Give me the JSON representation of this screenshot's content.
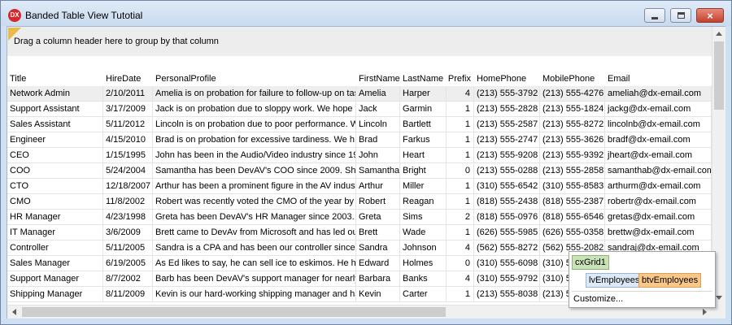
{
  "window": {
    "title": "Banded Table View Tutotial",
    "app_icon": "DX",
    "controls": {
      "minimize": "minimize-icon",
      "maximize": "maximize-icon",
      "close": "×"
    }
  },
  "group_panel": {
    "text": "Drag a column header here to group by that column"
  },
  "columns": [
    "Title",
    "HireDate",
    "PersonalProfile",
    "FirstName",
    "LastName",
    "Prefix",
    "HomePhone",
    "MobilePhone",
    "Email"
  ],
  "rows": [
    [
      "Network Admin",
      "2/10/2011",
      "Amelia is on probation for failure to follow-up on tas",
      "Amelia",
      "Harper",
      "4",
      "(213) 555-3792",
      "(213) 555-4276",
      "ameliah@dx-email.com"
    ],
    [
      "Support Assistant",
      "3/17/2009",
      "Jack is on probation due to sloppy work. We hope t",
      "Jack",
      "Garmin",
      "1",
      "(213) 555-2828",
      "(213) 555-1824",
      "jackg@dx-email.com"
    ],
    [
      "Sales Assistant",
      "5/11/2012",
      "Lincoln is on probation due to poor performance. W",
      "Lincoln",
      "Bartlett",
      "1",
      "(213) 555-2587",
      "(213) 555-8272",
      "lincolnb@dx-email.com"
    ],
    [
      "Engineer",
      "4/15/2010",
      "Brad is on probation for excessive tardiness.  We h",
      "Brad",
      "Farkus",
      "1",
      "(213) 555-2747",
      "(213) 555-3626",
      "bradf@dx-email.com"
    ],
    [
      "CEO",
      "1/15/1995",
      "John has been in the Audio/Video industry since 19",
      "John",
      "Heart",
      "1",
      "(213) 555-9208",
      "(213) 555-9392",
      "jheart@dx-email.com"
    ],
    [
      "COO",
      "5/24/2004",
      "Samantha has been DevAV's COO since 2009. She",
      "Samantha",
      "Bright",
      "0",
      "(213) 555-0288",
      "(213) 555-2858",
      "samanthab@dx-email.com"
    ],
    [
      "CTO",
      "12/18/2007",
      "Arthur has been a prominent figure in the AV indust",
      "Arthur",
      "Miller",
      "1",
      "(310) 555-6542",
      "(310) 555-8583",
      "arthurm@dx-email.com"
    ],
    [
      "CMO",
      "11/8/2002",
      "Robert was recently voted the CMO of the year by",
      "Robert",
      "Reagan",
      "1",
      "(818) 555-2438",
      "(818) 555-2387",
      "robertr@dx-email.com"
    ],
    [
      "HR Manager",
      "4/23/1998",
      "Greta has been DevAV's HR Manager since 2003. S",
      "Greta",
      "Sims",
      "2",
      "(818) 555-0976",
      "(818) 555-6546",
      "gretas@dx-email.com"
    ],
    [
      "IT Manager",
      "3/6/2009",
      "Brett came to DevAv from Microsoft and has led ou",
      "Brett",
      "Wade",
      "1",
      "(626) 555-5985",
      "(626) 555-0358",
      "brettw@dx-email.com"
    ],
    [
      "Controller",
      "5/11/2005",
      "Sandra is a CPA and has been our controller since 2",
      "Sandra",
      "Johnson",
      "4",
      "(562) 555-8272",
      "(562) 555-2082",
      "sandraj@dx-email.com"
    ],
    [
      "Sales Manager",
      "6/19/2005",
      "As Ed likes to say, he can sell ice to eskimos. He ha",
      "Edward",
      "Holmes",
      "0",
      "(310) 555-6098",
      "(310) 555-1",
      ""
    ],
    [
      "Support Manager",
      "8/7/2002",
      "Barb has been DevAV's support manager for nearly",
      "Barbara",
      "Banks",
      "4",
      "(310) 555-9792",
      "(310) 555-",
      ""
    ],
    [
      "Shipping Manager",
      "8/11/2009",
      "Kevin is our hard-working shipping manager and ha",
      "Kevin",
      "Carter",
      "1",
      "(213) 555-8038",
      "(213) 555-",
      ""
    ]
  ],
  "popup": {
    "grid": "cxGrid1",
    "level": "lvEmployees",
    "view": "btvEmployees",
    "customize": "Customize..."
  }
}
